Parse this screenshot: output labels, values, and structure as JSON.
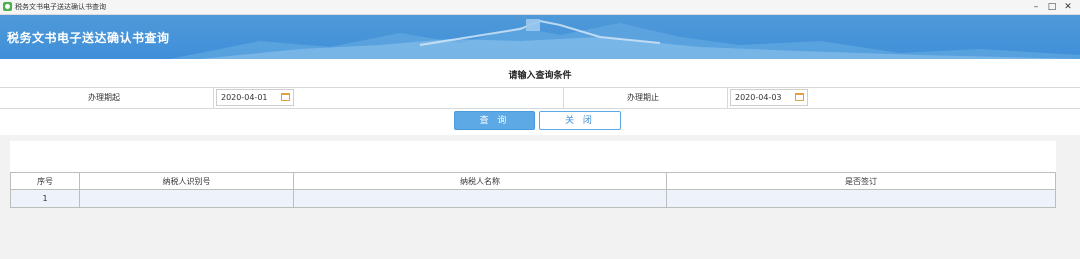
{
  "window": {
    "title": "税务文书电子送达确认书查询",
    "controls": [
      "–",
      "□",
      "✕"
    ]
  },
  "banner": {
    "title": "税务文书电子送达确认书查询"
  },
  "query": {
    "heading": "请输入查询条件",
    "start_label": "办理期起",
    "start_value": "2020-04-01",
    "end_label": "办理期止",
    "end_value": "2020-04-03",
    "query_button": "查 询",
    "close_button": "关 闭"
  },
  "table": {
    "headers": [
      "序号",
      "纳税人识别号",
      "纳税人名称",
      "是否签订"
    ],
    "rows": [
      [
        "1",
        "",
        "",
        ""
      ]
    ]
  },
  "colors": {
    "banner": "#4f99d8",
    "primary_button": "#5da9e6",
    "calendar_icon": "#e3a23b",
    "row_highlight": "#eef2fb"
  }
}
